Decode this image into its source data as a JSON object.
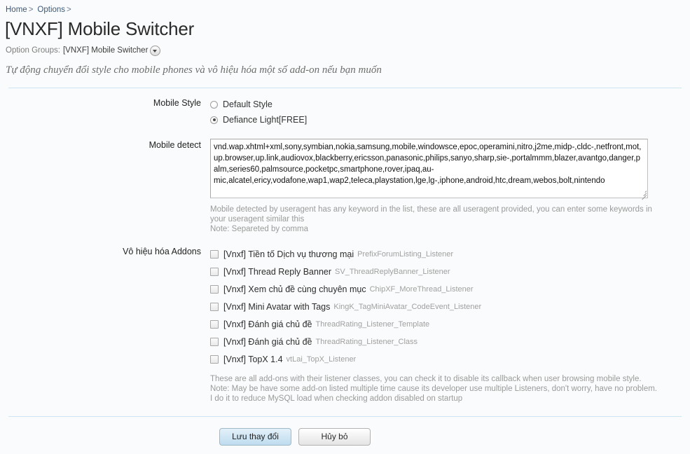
{
  "breadcrumb": {
    "items": [
      {
        "label": "Home",
        "separator": ">"
      },
      {
        "label": "Options",
        "separator": ">"
      }
    ]
  },
  "header": {
    "title": "[VNXF] Mobile Switcher",
    "option_groups_label": "Option Groups:",
    "option_groups_value": "[VNXF] Mobile Switcher",
    "caret_icon": "chevron-down-circle-icon",
    "description": "Tự động chuyển đổi style cho mobile phones và vô hiệu hóa một số add-on nếu bạn muốn"
  },
  "form": {
    "mobile_style": {
      "label": "Mobile Style",
      "options": [
        {
          "label": "Default Style",
          "checked": false
        },
        {
          "label": "Defiance Light[FREE]",
          "checked": true
        }
      ]
    },
    "mobile_detect": {
      "label": "Mobile detect",
      "value": "vnd.wap.xhtml+xml,sony,symbian,nokia,samsung,mobile,windowsce,epoc,operamini,nitro,j2me,midp-,cldc-,netfront,mot,up.browser,up.link,audiovox,blackberry,ericsson,panasonic,philips,sanyo,sharp,sie-,portalmmm,blazer,avantgo,danger,palm,series60,palmsource,pocketpc,smartphone,rover,ipaq,au-mic,alcatel,ericy,vodafone,wap1,wap2,teleca,playstation,lge,lg-,iphone,android,htc,dream,webos,bolt,nintendo",
      "hint_line1": "Mobile detected by useragent has any keyword in the list, these are all useragent provided, you can enter some keywords in your useragent similar this",
      "hint_line2": "Note: Separeted by comma"
    },
    "disable_addons": {
      "label": "Vô hiệu hóa Addons",
      "items": [
        {
          "label": "[Vnxf] Tiền tố Dịch vụ thương mại",
          "listener": "PrefixForumListing_Listener",
          "checked": false
        },
        {
          "label": "[Vnxf] Thread Reply Banner",
          "listener": "SV_ThreadReplyBanner_Listener",
          "checked": false
        },
        {
          "label": "[Vnxf] Xem chủ đề cùng chuyên mục",
          "listener": "ChipXF_MoreThread_Listener",
          "checked": false
        },
        {
          "label": "[Vnxf] Mini Avatar with Tags",
          "listener": "KingK_TagMiniAvatar_CodeEvent_Listener",
          "checked": false
        },
        {
          "label": "[Vnxf] Đánh giá chủ đề",
          "listener": "ThreadRating_Listener_Template",
          "checked": false
        },
        {
          "label": "[Vnxf] Đánh giá chủ đề",
          "listener": "ThreadRating_Listener_Class",
          "checked": false
        },
        {
          "label": "[Vnxf] TopX 1.4",
          "listener": "vtLai_TopX_Listener",
          "checked": false
        }
      ],
      "hint_line1": "These are all add-ons with their listener classes, you can check it to disable its callback when user browsing mobile style.",
      "hint_line2": "Note: May be have some add-on listed multiple time cause its developer use multiple Listeners, don't worry, have no problem. I do it to reduce MySQL load when checking addon disabled on startup"
    }
  },
  "footer": {
    "save_label": "Lưu thay đổi",
    "cancel_label": "Hủy bỏ"
  },
  "colors": {
    "background": "#fafbfc",
    "rule": "#cfe6f2",
    "link": "#3c5a78",
    "hint": "#9a9a9a",
    "primary_button": "#bedcef"
  }
}
